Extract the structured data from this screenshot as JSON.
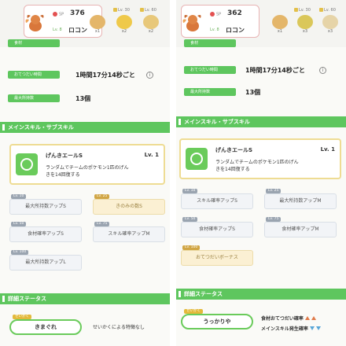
{
  "left": {
    "sp_label": "SP",
    "sp_value": "376",
    "level": "Lv. 8",
    "name": "ロコン",
    "ingredients": [
      {
        "level": "",
        "count": "x1",
        "color": "#e4b66a"
      },
      {
        "level": "Lv. 30",
        "count": "x2",
        "color": "#efc94a"
      },
      {
        "level": "Lv. 60",
        "count": "x2",
        "color": "#e8c87a"
      }
    ],
    "ing_label": "食材",
    "help_label": "おてつだい時間",
    "help_value": "1時間17分14秒ごと",
    "carry_label": "最大所持数",
    "carry_value": "13個",
    "section_skill": "メインスキル・サブスキル",
    "skill_name": "げんきエールS",
    "skill_lv": "Lv. 1",
    "skill_desc": "ランダムでチームのポケモン1匹のげんきを14回復する",
    "subs": [
      {
        "lv": "Lv. 10",
        "label": "最大所持数アップS",
        "style": "gray"
      },
      {
        "lv": "Lv. 25",
        "label": "きのみの数S",
        "style": "gold"
      },
      {
        "lv": "Lv. 50",
        "label": "食材確率アップS",
        "style": "gray"
      },
      {
        "lv": "Lv. 75",
        "label": "スキル確率アップM",
        "style": "gray"
      },
      {
        "lv": "Lv. 100",
        "label": "最大所持数アップL",
        "style": "gray"
      }
    ],
    "section_status": "詳細ステータス",
    "nature_badge": "せいかく",
    "nature": "きまぐれ",
    "nature_effect": "せいかくによる特徴なし"
  },
  "right": {
    "sp_label": "SP",
    "sp_value": "362",
    "level": "Lv. 8",
    "name": "ロコン",
    "ingredients": [
      {
        "level": "",
        "count": "x1",
        "color": "#e4b66a"
      },
      {
        "level": "Lv. 30",
        "count": "x3",
        "color": "#dac75a"
      },
      {
        "level": "Lv. 60",
        "count": "x3",
        "color": "#e6d4a8"
      }
    ],
    "ing_label": "食材",
    "help_label": "おてつだい時間",
    "help_value": "1時間17分14秒ごと",
    "carry_label": "最大所持数",
    "carry_value": "13個",
    "section_skill": "メインスキル・サブスキル",
    "skill_name": "げんきエールS",
    "skill_lv": "Lv. 1",
    "skill_desc": "ランダムでチームのポケモン1匹のげんきを14回復する",
    "subs": [
      {
        "lv": "Lv. 10",
        "label": "スキル確率アップS",
        "style": "gray"
      },
      {
        "lv": "Lv. 25",
        "label": "最大所持数アップM",
        "style": "gray"
      },
      {
        "lv": "Lv. 50",
        "label": "食材確率アップS",
        "style": "gray"
      },
      {
        "lv": "Lv. 75",
        "label": "食材確率アップM",
        "style": "gray"
      },
      {
        "lv": "Lv. 100",
        "label": "おてつだいボーナス",
        "style": "gold"
      }
    ],
    "section_status": "詳細ステータス",
    "nature_badge": "せいかく",
    "nature": "うっかりや",
    "nature_up": "食材おてつだい確率",
    "nature_down": "メインスキル発生確率"
  }
}
